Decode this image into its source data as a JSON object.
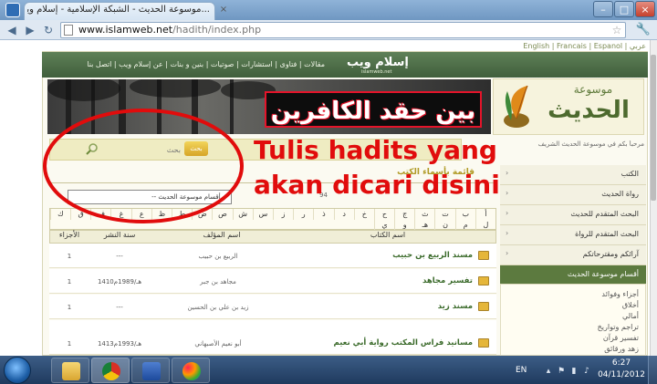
{
  "browser": {
    "tab_title": "...موسوعة الحديث - الشبكة الإسلامية - إسلام ويب",
    "tab_close": "×",
    "url_host": "www.islamweb.net",
    "url_path": "/hadith/index.php",
    "min_glyph": "–",
    "max_glyph": "□",
    "close_glyph": "×",
    "back_glyph": "◀",
    "forward_glyph": "▶",
    "reload_glyph": "↻",
    "star_glyph": "☆",
    "wrench_glyph": "🔧"
  },
  "site": {
    "language_links": "English | Francais | Espanol | عربي",
    "top_nav": "مقالات | فتاوى | استشارات | صوتيات | بنين و بنات | عن إسلام ويب | اتصل بنا",
    "logo_text": "إسلام ويب",
    "logo_sub": "islamweb.net",
    "banner_text": "بين حقد الكافرين",
    "mawsoua_line1": "موسوعة",
    "mawsoua_line2": "الحديث",
    "welcome_text": "مرحباً بكم في موسوعة الحديث الشريف",
    "search_button": "بحث",
    "search_placeholder": "بحث"
  },
  "annotation": {
    "text": "Tulis hadits yang akan dicari disini",
    "color": "#e10c0c"
  },
  "sidebar": {
    "items": [
      {
        "label": "الكتب"
      },
      {
        "label": "رواة الحديث"
      },
      {
        "label": "البحث المتقدم للحديث"
      },
      {
        "label": "البحث المتقدم للرواة"
      },
      {
        "label": "آرائكم ومقترحاتكم"
      }
    ],
    "arrow_glyph": "‹",
    "sections_title": "أقسام موسوعة الحديث",
    "sections": [
      "أجزاء وفوائد",
      "أخلاق",
      "أمالي",
      "تراجم وتواريخ",
      "تفسير قرآن",
      "زهد ورقائق"
    ]
  },
  "content": {
    "title": "قائمة بأسماء الكتب",
    "dropdown_label": "-- أقسام موسوعة الحديث --",
    "page_number": "94",
    "letters_row1": [
      "أ",
      "ب",
      "ت",
      "ث",
      "ج",
      "ح",
      "خ",
      "د",
      "ذ",
      "ر",
      "ز",
      "س",
      "ش",
      "ص",
      "ض",
      "ط",
      "ظ",
      "ع",
      "غ",
      "ف",
      "ق",
      "ك"
    ],
    "letters_row2": [
      "ل",
      "م",
      "ن",
      "هـ",
      "و",
      "ي"
    ],
    "columns": {
      "name": "اسم الكتاب",
      "author": "اسم المؤلف",
      "year": "سنة النشر",
      "parts": "الأجزاء"
    },
    "rows": [
      {
        "name": "مسند الربيع بن حبيب",
        "author": "الربيع بن حبيب",
        "year": "---",
        "parts": "1"
      },
      {
        "name": "تفسير مجاهد",
        "author": "مجاهد بن جبر",
        "year": "1410هـ/1989م",
        "parts": "1"
      },
      {
        "name": "مسند زيد",
        "author": "زيد بن علي بن الحسين",
        "year": "---",
        "parts": "1"
      },
      {
        "name": "مسانيد فراس المكتب رواية أبي نعيم",
        "author": "أبو نعيم الأصبهاني",
        "year": "1413هـ/1993م",
        "parts": "1"
      }
    ]
  },
  "taskbar": {
    "lang": "EN",
    "time": "6:27",
    "date": "04/11/2012"
  }
}
